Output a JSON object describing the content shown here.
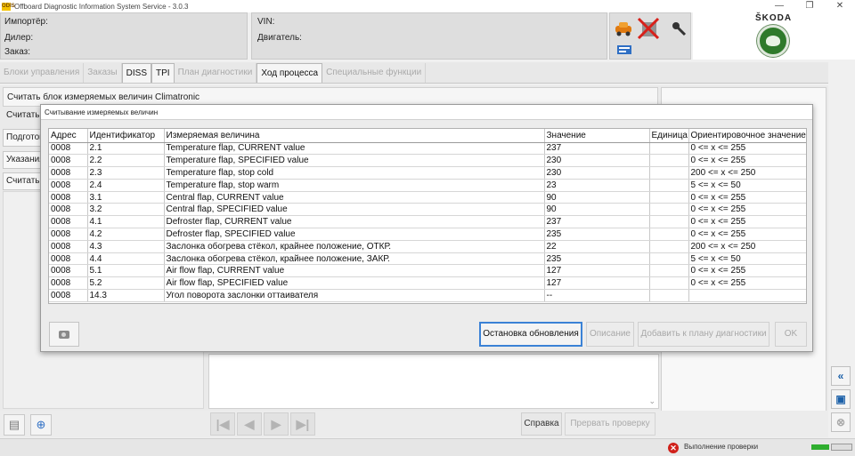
{
  "window": {
    "title": "Offboard Diagnostic Information System Service - 3.0.3",
    "app_icon": "ODIS",
    "controls": [
      "—",
      "❐",
      "✕"
    ]
  },
  "header": {
    "importer_label": "Импортёр:",
    "dealer_label": "Дилер:",
    "order_label": "Заказ:",
    "vin_label": "VIN:",
    "engine_label": "Двигатель:",
    "brand": "ŠKODA",
    "icons": [
      "car-connection-icon",
      "no-connection-icon",
      "key-icon",
      "usb-icon"
    ]
  },
  "tabs": [
    {
      "label": "Блоки управления",
      "active": false
    },
    {
      "label": "Заказы",
      "active": false
    },
    {
      "label": "DISS",
      "active": true
    },
    {
      "label": "TPI",
      "active": true
    },
    {
      "label": "План диагностики",
      "active": false
    },
    {
      "label": "Ход процесса",
      "active": true
    },
    {
      "label": "Специальные функции",
      "active": false
    }
  ],
  "background": {
    "panel_title": "Считать блок измеряемых величин Climatronic",
    "read_label": "Считать",
    "side_buttons": [
      "Подготовка",
      "Указания",
      "Считать"
    ],
    "help_label": "Справка",
    "interrupt_label": "Прервать проверку",
    "nav_icons": [
      "first-icon",
      "prev-icon",
      "next-icon",
      "last-icon"
    ],
    "scroll_glyph": "⌄"
  },
  "dialog": {
    "title": "Считывание измеряемых величин",
    "columns": [
      "Адрес",
      "Идентификатор",
      "Измеряемая величина",
      "Значение",
      "Единица",
      "Ориентировочное значение"
    ],
    "rows": [
      [
        "0008",
        "2.1",
        "Temperature flap, CURRENT value",
        "237",
        "",
        "0 <= x <= 255"
      ],
      [
        "0008",
        "2.2",
        "Temperature flap, SPECIFIED value",
        "230",
        "",
        "0 <= x <= 255"
      ],
      [
        "0008",
        "2.3",
        "Temperature flap, stop cold",
        "230",
        "",
        "200 <= x <= 250"
      ],
      [
        "0008",
        "2.4",
        "Temperature flap, stop warm",
        "23",
        "",
        "5 <= x <= 50"
      ],
      [
        "0008",
        "3.1",
        "Central flap, CURRENT value",
        "90",
        "",
        "0 <= x <= 255"
      ],
      [
        "0008",
        "3.2",
        "Central flap, SPECIFIED value",
        "90",
        "",
        "0 <= x <= 255"
      ],
      [
        "0008",
        "4.1",
        "Defroster flap, CURRENT value",
        "237",
        "",
        "0 <= x <= 255"
      ],
      [
        "0008",
        "4.2",
        "Defroster flap, SPECIFIED value",
        "235",
        "",
        "0 <= x <= 255"
      ],
      [
        "0008",
        "4.3",
        "Заслонка обогрева стёкол, крайнее положение, ОТКР.",
        "22",
        "",
        "200 <= x <= 250"
      ],
      [
        "0008",
        "4.4",
        "Заслонка обогрева стёкол, крайнее положение, ЗАКР.",
        "235",
        "",
        "5 <= x <= 50"
      ],
      [
        "0008",
        "5.1",
        "Air flow flap, CURRENT value",
        "127",
        "",
        "0 <= x <= 255"
      ],
      [
        "0008",
        "5.2",
        "Air flow flap, SPECIFIED value",
        "127",
        "",
        "0 <= x <= 255"
      ],
      [
        "0008",
        "14.3",
        "Угол поворота заслонки оттаивателя",
        "--",
        "",
        ""
      ]
    ],
    "buttons": {
      "stop_update": "Остановка обновления",
      "description": "Описание",
      "add_to_plan": "Добавить к плану диагностики",
      "ok": "OK"
    }
  },
  "status": {
    "text": "Выполнение проверки",
    "error_glyph": "✕"
  },
  "colors": {
    "accent": "#3b82d6",
    "skoda_green": "#2f7a2b",
    "error": "#d0201a"
  }
}
